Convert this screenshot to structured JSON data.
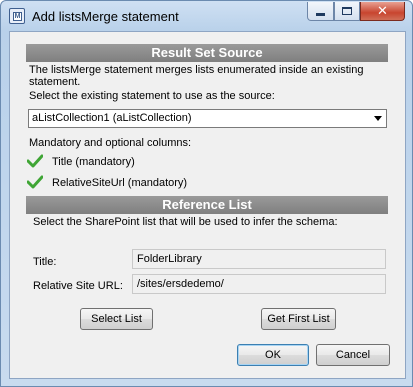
{
  "window": {
    "title": "Add listsMerge statement",
    "icon_letter": "M"
  },
  "result_set_source": {
    "header": "Result Set Source",
    "description_line1": "The listsMerge statement merges lists enumerated inside an existing",
    "description_line2": "statement.",
    "select_label": "Select the existing statement to use as the source:",
    "selected_statement": "aListCollection1 (aListCollection)",
    "columns_label": "Mandatory and optional columns:",
    "columns": [
      {
        "label": "Title (mandatory)",
        "icon": "checkmark-icon"
      },
      {
        "label": "RelativeSiteUrl (mandatory)",
        "icon": "checkmark-icon"
      }
    ]
  },
  "reference_list": {
    "header": "Reference List",
    "select_label": "Select the SharePoint list that will be used to infer the schema:",
    "title_label": "Title:",
    "title_value": "FolderLibrary",
    "url_label": "Relative Site URL:",
    "url_value": "/sites/ersdedemo/"
  },
  "buttons": {
    "select_list": "Select List",
    "get_first_list": "Get First List",
    "ok": "OK",
    "cancel": "Cancel"
  },
  "colors": {
    "header_bg": "#8a8a8a",
    "check_green": "#3fa535"
  }
}
